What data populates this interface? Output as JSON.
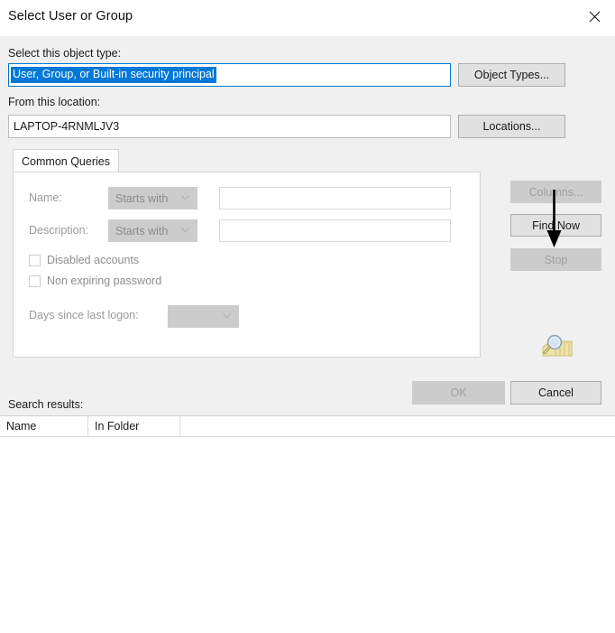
{
  "window": {
    "title": "Select User or Group",
    "close_icon": "close-icon"
  },
  "object_type": {
    "label": "Select this object type:",
    "value": "User, Group, or Built-in security principal",
    "button_label": "Object Types..."
  },
  "location": {
    "label": "From this location:",
    "value": "LAPTOP-4RNMLJV3",
    "button_label": "Locations..."
  },
  "tabs": [
    {
      "label": "Common Queries",
      "active": true
    }
  ],
  "query": {
    "name": {
      "label": "Name:",
      "condition": "Starts with",
      "value": "",
      "placeholder": ""
    },
    "description": {
      "label": "Description:",
      "condition": "Starts with",
      "value": "",
      "placeholder": ""
    },
    "disabled_accounts": {
      "label": "Disabled accounts",
      "checked": false
    },
    "non_expiring_password": {
      "label": "Non expiring password",
      "checked": false
    },
    "days_since_last_logon": {
      "label": "Days since last logon:",
      "value": ""
    }
  },
  "side_buttons": {
    "columns": "Columns...",
    "find_now": "Find Now",
    "stop": "Stop"
  },
  "annotation": {
    "arrow_icon": "down-arrow-annotation",
    "target": "Find Now",
    "color": "#000000"
  },
  "search_graphic": {
    "icon": "magnifier-folder-icon"
  },
  "footer": {
    "ok_label": "OK",
    "cancel_label": "Cancel"
  },
  "results": {
    "label": "Search results:",
    "columns": [
      "Name",
      "In Folder"
    ],
    "rows": []
  },
  "colors": {
    "dialog_background": "#f0f0f0",
    "selection_blue": "#0078d7",
    "button_face": "#e1e1e1",
    "disabled_face": "#cccccc",
    "disabled_text": "#a0a0a0",
    "icon_yellow": "#e8d98a"
  }
}
